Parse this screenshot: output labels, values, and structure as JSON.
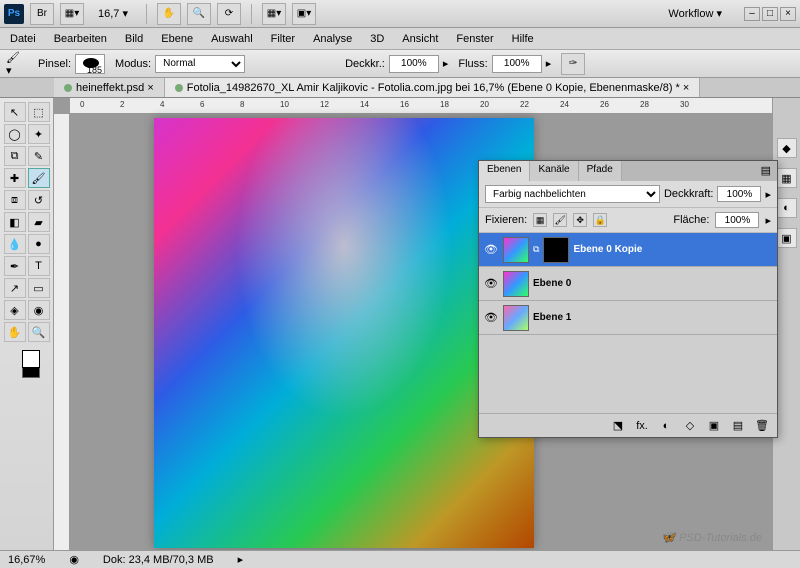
{
  "topbar": {
    "app": "Ps",
    "zoom_display": "16,7 ▾",
    "workflow_label": "Workflow ▾"
  },
  "menu": {
    "items": [
      "Datei",
      "Bearbeiten",
      "Bild",
      "Ebene",
      "Auswahl",
      "Filter",
      "Analyse",
      "3D",
      "Ansicht",
      "Fenster",
      "Hilfe"
    ]
  },
  "options": {
    "brush_label": "Pinsel:",
    "brush_size": "185",
    "mode_label": "Modus:",
    "mode_value": "Normal",
    "opacity_label": "Deckkr.:",
    "opacity_value": "100%",
    "flow_label": "Fluss:",
    "flow_value": "100%"
  },
  "tabs": [
    {
      "label": "heineffekt.psd ×",
      "active": false
    },
    {
      "label": "Fotolia_14982670_XL Amir Kaljikovic - Fotolia.com.jpg bei 16,7% (Ebene 0 Kopie, Ebenenmaske/8) * ×",
      "active": true
    }
  ],
  "layers_panel": {
    "tabs": [
      "Ebenen",
      "Kanäle",
      "Pfade"
    ],
    "blend_mode": "Farbig nachbelichten",
    "opacity_label": "Deckkraft:",
    "opacity": "100%",
    "lock_label": "Fixieren:",
    "fill_label": "Fläche:",
    "fill": "100%",
    "layers": [
      {
        "name": "Ebene 0 Kopie",
        "selected": true,
        "has_mask": true
      },
      {
        "name": "Ebene 0",
        "selected": false,
        "has_mask": false
      },
      {
        "name": "Ebene 1",
        "selected": false,
        "has_mask": false
      }
    ],
    "bottom_icons": [
      "⬔",
      "fx.",
      "◐",
      "◇",
      "▣",
      "▤",
      "🗑"
    ]
  },
  "ruler_marks": [
    "0",
    "2",
    "4",
    "6",
    "8",
    "10",
    "12",
    "14",
    "16",
    "18",
    "20",
    "22",
    "24",
    "26",
    "28",
    "30"
  ],
  "status": {
    "zoom": "16,67%",
    "doc_info": "Dok: 23,4 MB/70,3 MB"
  },
  "watermark": "PSD-Tutorials.de"
}
